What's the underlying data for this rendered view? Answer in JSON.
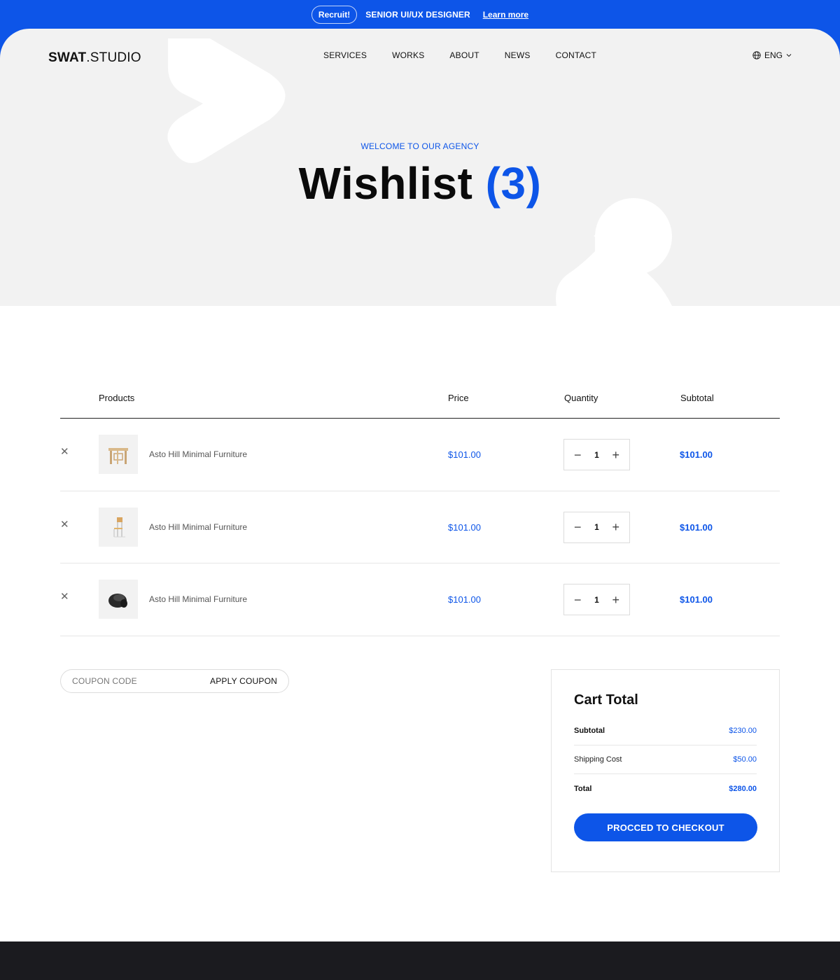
{
  "announcement": {
    "badge": "Recruit!",
    "role": "SENIOR UI/UX DESIGNER",
    "link": "Learn more"
  },
  "header": {
    "logo_bold": "SWAT",
    "logo_rest": ".STUDIO",
    "nav": [
      "SERVICES",
      "WORKS",
      "ABOUT",
      "NEWS",
      "CONTACT"
    ],
    "language": "ENG"
  },
  "hero": {
    "eyebrow": "WELCOME TO OUR AGENCY",
    "title": "Wishlist",
    "count": "(3)"
  },
  "table": {
    "headers": [
      "Products",
      "Price",
      "Quantity",
      "Subtotal"
    ],
    "rows": [
      {
        "name": "Asto Hill Minimal Furniture",
        "price": "$101.00",
        "qty": "1",
        "subtotal": "$101.00"
      },
      {
        "name": "Asto Hill Minimal Furniture",
        "price": "$101.00",
        "qty": "1",
        "subtotal": "$101.00"
      },
      {
        "name": "Asto Hill Minimal Furniture",
        "price": "$101.00",
        "qty": "1",
        "subtotal": "$101.00"
      }
    ]
  },
  "coupon": {
    "placeholder": "COUPON CODE",
    "button": "APPLY COUPON"
  },
  "cart_total": {
    "title": "Cart Total",
    "subtotal_label": "Subtotal",
    "subtotal_value": "$230.00",
    "shipping_label": "Shipping Cost",
    "shipping_value": "$50.00",
    "total_label": "Total",
    "total_value": "$280.00",
    "checkout": "PROCCED TO CHECKOUT"
  },
  "colors": {
    "accent": "#0d55e8",
    "hero_bg": "#f2f2f2",
    "footer_bg": "#1b1b1f"
  }
}
